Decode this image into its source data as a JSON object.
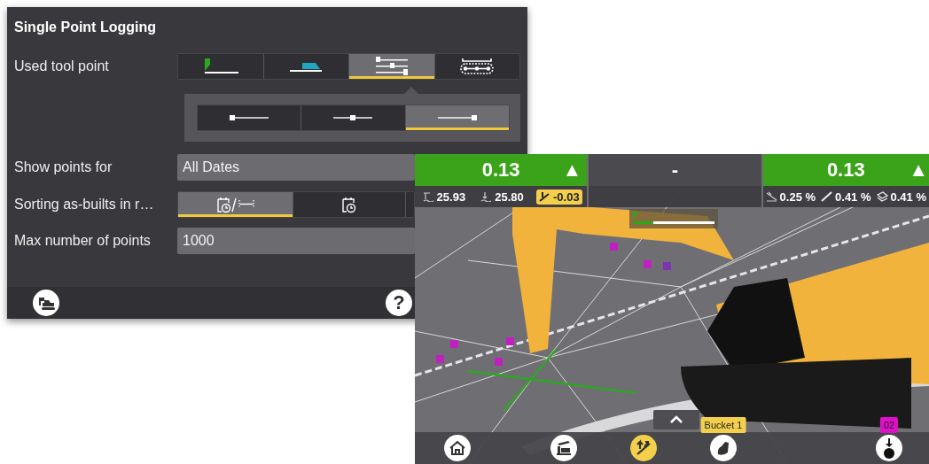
{
  "settings": {
    "title": "Single Point Logging",
    "tool_point": {
      "label": "Used tool point",
      "options": [
        {
          "selected": false
        },
        {
          "selected": false
        },
        {
          "selected": true
        },
        {
          "selected": false
        }
      ],
      "sub_options": [
        {
          "selected": false
        },
        {
          "selected": false
        },
        {
          "selected": true
        }
      ]
    },
    "show_points": {
      "label": "Show points for",
      "value": "All Dates"
    },
    "sorting": {
      "label": "Sorting as-builts in r…",
      "options": [
        {
          "selected": true
        },
        {
          "selected": false
        },
        {
          "selected": false
        }
      ]
    },
    "max_points": {
      "label": "Max number of points",
      "value": "1000"
    },
    "help_label": "?"
  },
  "machine_view": {
    "guidance": [
      {
        "value": "0.13",
        "color": "#3aa31a",
        "arrow": "▲",
        "readings": [
          {
            "text": "25.93",
            "highlighted": false
          },
          {
            "text": "25.80",
            "highlighted": false
          },
          {
            "text": "-0.03",
            "highlighted": true
          }
        ]
      },
      {
        "value": "-",
        "color": "#4a4a4f"
      },
      {
        "value": "0.13",
        "color": "#3aa31a",
        "arrow": "▲",
        "readings": [
          {
            "text": "0.25 %",
            "highlighted": false
          },
          {
            "text": "0.41 %",
            "highlighted": false
          },
          {
            "text": "0.41 %",
            "highlighted": false
          }
        ]
      }
    ],
    "level_indicator": {
      "level": 0.25
    },
    "toolbar": [
      {
        "selected": false
      },
      {
        "selected": false
      },
      {
        "selected": true
      },
      {
        "selected": false,
        "tag": {
          "text": "Bucket 1",
          "color": "#f3cf4c"
        }
      },
      {
        "selected": false,
        "tag": {
          "text": "02",
          "color": "#e010c8"
        }
      }
    ]
  }
}
